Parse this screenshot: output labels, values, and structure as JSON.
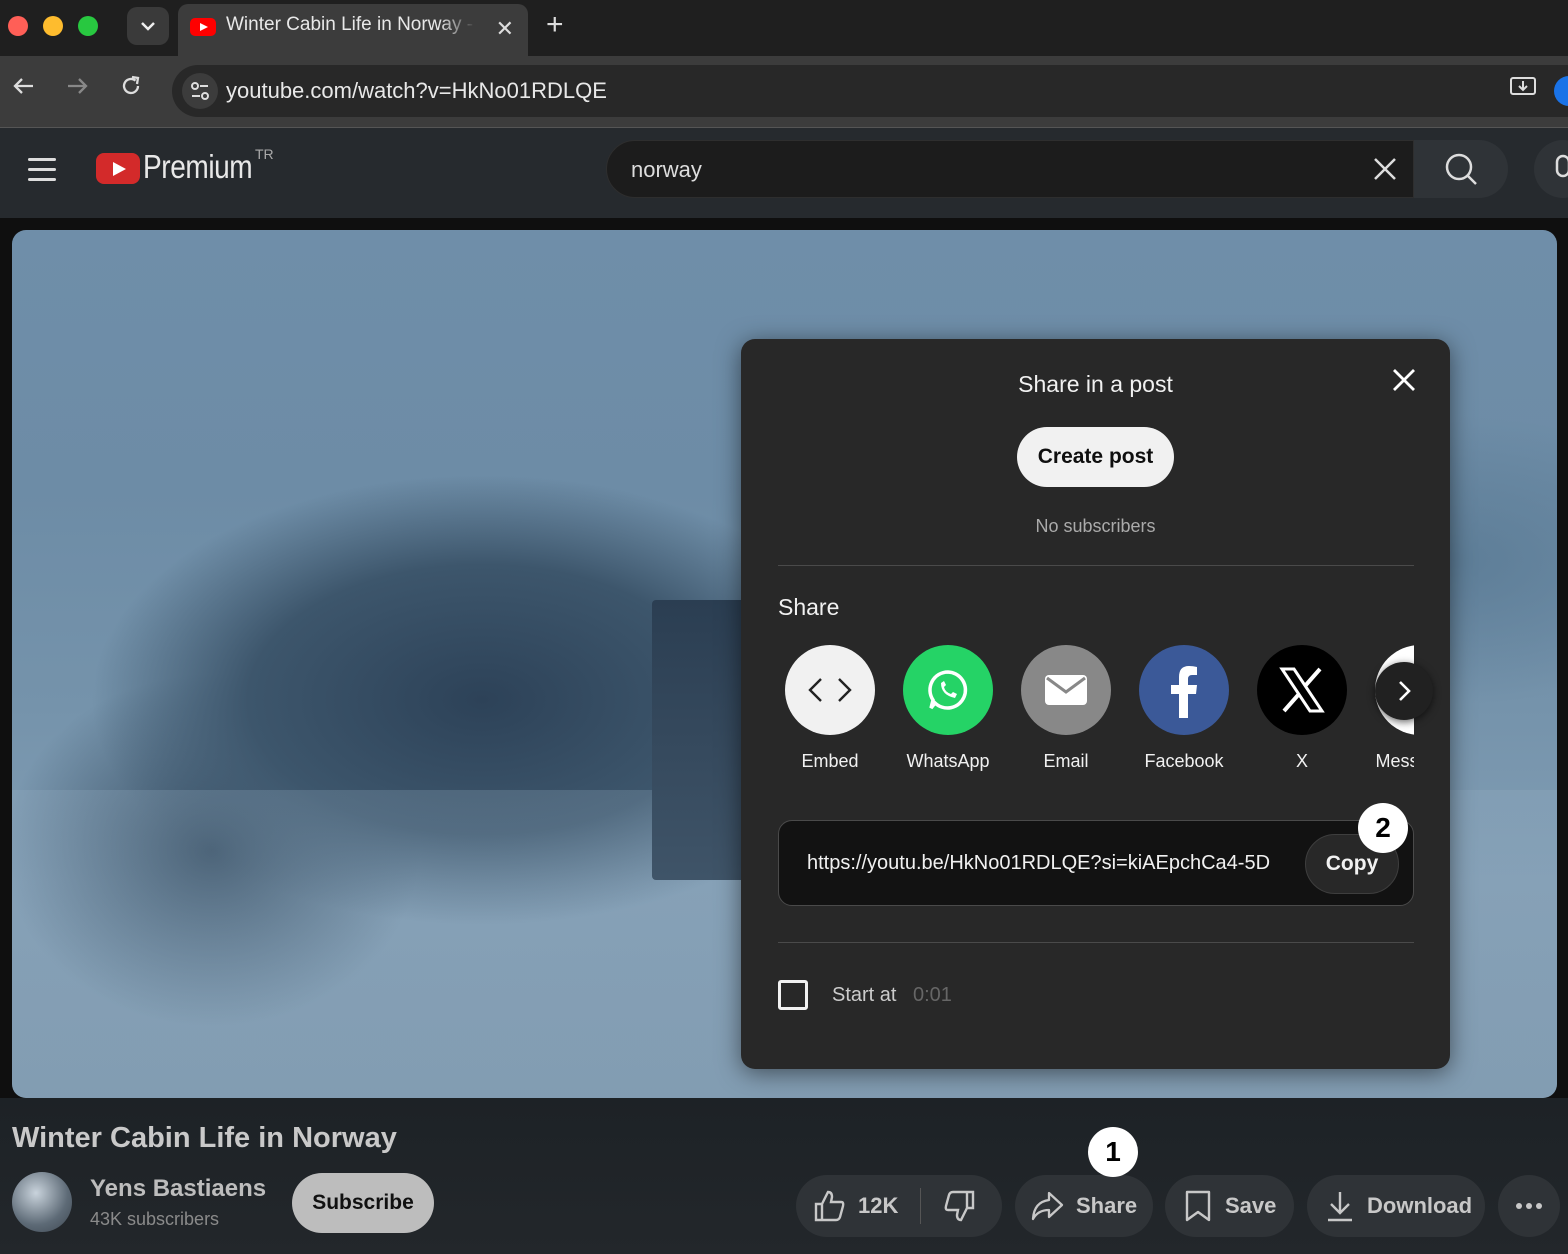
{
  "browser": {
    "tab_title": "Winter Cabin Life in Norway - YouTube",
    "url": "youtube.com/watch?v=HkNo01RDLQE",
    "new_tab_label": "+"
  },
  "youtube": {
    "brand": "Premium",
    "region": "TR",
    "search_value": "norway"
  },
  "share_dialog": {
    "title": "Share in a post",
    "create_post_label": "Create post",
    "subscriber_note": "No subscribers",
    "share_heading": "Share",
    "targets": [
      {
        "label": "Embed",
        "icon": "embed-icon",
        "color": "#f1f1f1"
      },
      {
        "label": "WhatsApp",
        "icon": "whatsapp-icon",
        "color": "#25d366"
      },
      {
        "label": "Email",
        "icon": "email-icon",
        "color": "#888888"
      },
      {
        "label": "Facebook",
        "icon": "facebook-icon",
        "color": "#3b5998"
      },
      {
        "label": "X",
        "icon": "x-icon",
        "color": "#000000"
      },
      {
        "label": "Messenger",
        "icon": "messenger-icon",
        "color": "#ffffff"
      }
    ],
    "link": "https://youtu.be/HkNo01RDLQE?si=kiAEpchCa4-5D",
    "copy_label": "Copy",
    "start_at_label": "Start at",
    "start_at_time": "0:01"
  },
  "annotations": {
    "badge_1": "1",
    "badge_2": "2"
  },
  "video": {
    "title": "Winter Cabin Life in Norway",
    "channel_name": "Yens Bastiaens",
    "channel_subs": "43K subscribers",
    "subscribe_label": "Subscribe",
    "likes": "12K",
    "share_label": "Share",
    "save_label": "Save",
    "download_label": "Download"
  }
}
